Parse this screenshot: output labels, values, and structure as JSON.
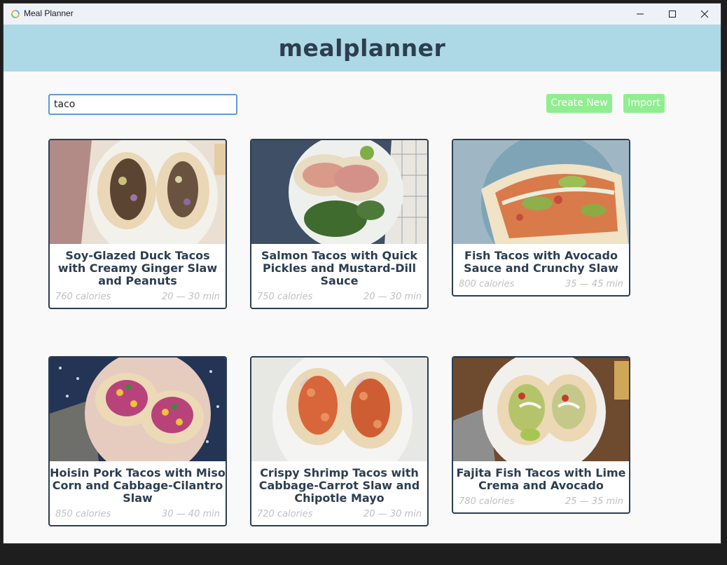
{
  "window": {
    "title": "Meal Planner"
  },
  "header": {
    "brand": "mealplanner"
  },
  "toolbar": {
    "search_value": "taco",
    "create_label": "Create New",
    "import_label": "Import"
  },
  "colors": {
    "header_bg": "#add8e6",
    "brand_text": "#2c3e50",
    "button_bg": "#90ee90",
    "card_border": "#2c3e50",
    "meta_text": "#c0c0c0"
  },
  "recipes": [
    {
      "name": "Soy-Glazed Duck Tacos with Creamy Ginger Slaw and Peanuts",
      "calories": "760 calories",
      "time": "20 — 30 min"
    },
    {
      "name": "Salmon Tacos with Quick Pickles and Mustard-Dill Sauce",
      "calories": "750 calories",
      "time": "20 — 30 min"
    },
    {
      "name": "Fish Tacos with Avocado Sauce and Crunchy Slaw",
      "calories": "800 calories",
      "time": "35 — 45 min"
    },
    {
      "name": "Hoisin Pork Tacos with Miso Corn and Cabbage-Cilantro Slaw",
      "calories": "850 calories",
      "time": "30 — 40 min"
    },
    {
      "name": "Crispy Shrimp Tacos with Cabbage-Carrot Slaw and Chipotle Mayo",
      "calories": "720 calories",
      "time": "20 — 30 min"
    },
    {
      "name": "Fajita Fish Tacos with Lime Crema and Avocado",
      "calories": "780 calories",
      "time": "25 — 35 min"
    }
  ]
}
